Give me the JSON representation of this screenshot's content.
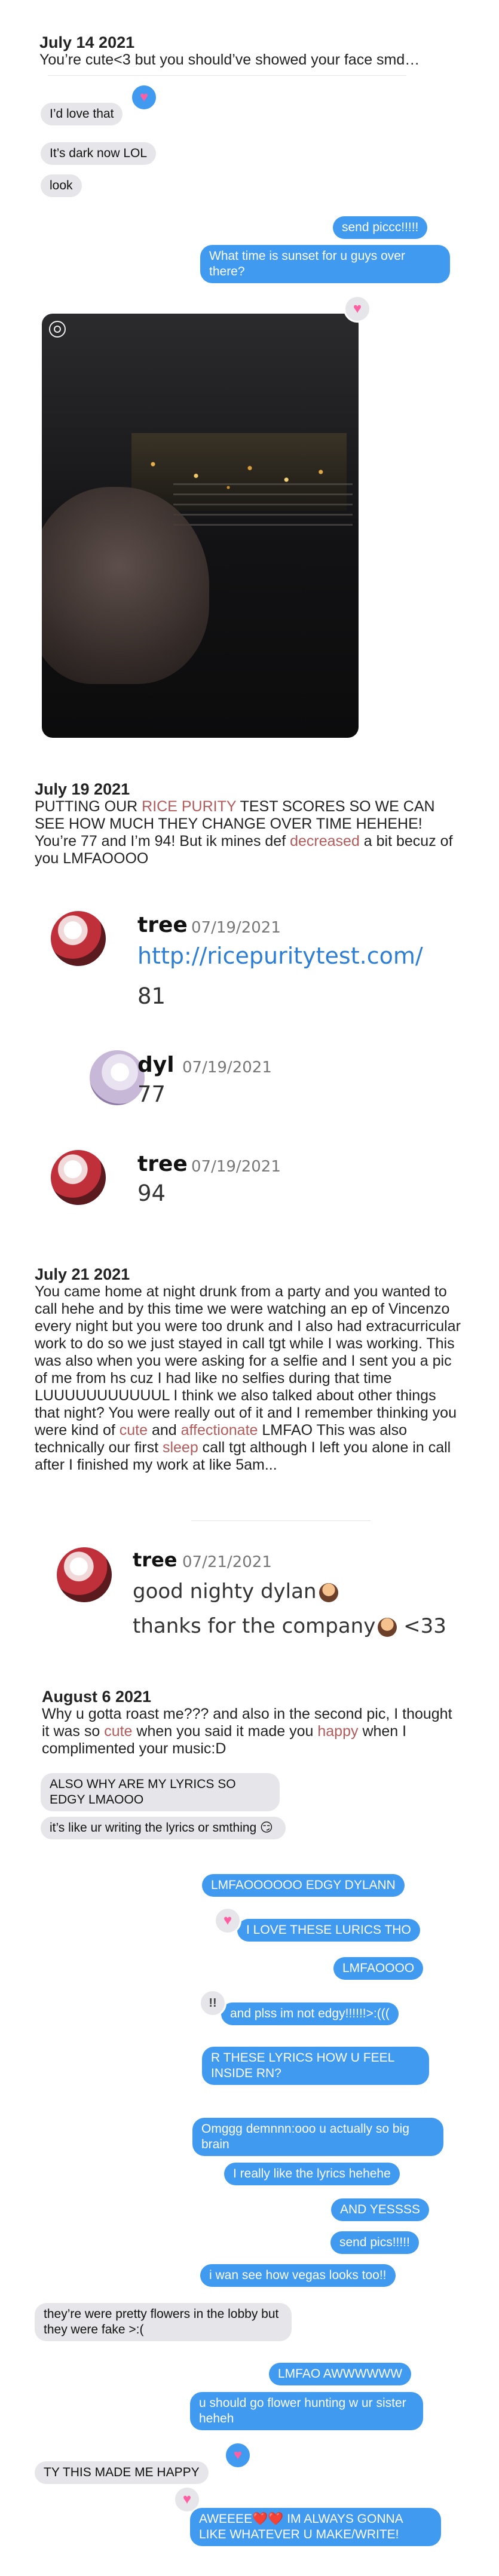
{
  "s1": {
    "date": "July 14 2021",
    "text": "You’re cute<3 but you should’ve showed your face smd…"
  },
  "m1": [
    {
      "text": "I’d love that"
    },
    {
      "text": "It’s dark now LOL"
    },
    {
      "text": "look"
    }
  ],
  "m1_out": [
    {
      "text": "send piccc!!!!!"
    },
    {
      "text": "What time is sunset for u guys over there?"
    }
  ],
  "s2": {
    "date": "July 19 2021",
    "p1": "PUTTING OUR ",
    "hl1": "RICE PURITY",
    "p2": " TEST SCORES SO WE CAN SEE HOW MUCH THEY CHANGE OVER TIME HEHEHE! You’re 77 and I’m 94! But ik mines def ",
    "hl2": "decreased",
    "p3": " a bit becuz of you LMFAOOOO"
  },
  "discord": [
    {
      "name": "tree",
      "date": "07/19/2021",
      "link": "http://ricepuritytest.com/",
      "msg": "81"
    },
    {
      "name": "dyl",
      "date": "07/19/2021",
      "msg": "77"
    },
    {
      "name": "tree",
      "date": "07/19/2021",
      "msg": "94"
    }
  ],
  "s3": {
    "date": "July 21 2021",
    "p1": "You came home at night drunk from a party and you wanted to call hehe and by this time we were watching an ep of Vincenzo every night but you were too drunk and I also had extracurricular work to do so we just stayed in call tgt while I was working. This was also when you were asking for a selfie and I sent you a pic of me from hs cuz I had like no selfies during that time LUUUUUUUUUUUL I think we also talked about other things that night? You were really out of it and I remember thinking you were kind of ",
    "hl1": "cute",
    "p2": " and ",
    "hl2": "affectionate",
    "p3": " LMFAO This was also technically our first ",
    "hl3": "sleep",
    "p4": " call tgt although I left you alone in call after I finished my work at like 5am..."
  },
  "discord2": {
    "name": "tree",
    "date": "07/21/2021",
    "msg1": "good nighty dylan",
    "msg2": "thanks for the company",
    "msg2_suffix": " <33"
  },
  "s4": {
    "date": "August 6 2021",
    "p1": "Why u gotta roast me??? and also in the second pic, I thought it was so ",
    "hl1": "cute",
    "p2": " when you said it made you ",
    "hl2": "happy",
    "p3": " when I complimented your music:D"
  },
  "m2": [
    {
      "text": "ALSO WHY ARE MY LYRICS SO EDGY LMAOOO"
    },
    {
      "text": "it’s like ur writing the lyrics or smthing 😏"
    },
    {
      "text": "LMFAOOOOOO EDGY DYLANN"
    },
    {
      "text": "I LOVE THESE LURICS THO"
    },
    {
      "text": "LMFAOOOO"
    },
    {
      "text": "and plss im not edgy!!!!!!>:((("
    },
    {
      "text": "R THESE LYRICS HOW U FEEL INSIDE RN?"
    },
    {
      "text": "Omggg demnnn:ooo u actually so big brain"
    },
    {
      "text": "I really like the lyrics hehehe"
    },
    {
      "text": "AND YESSSS"
    },
    {
      "text": "send pics!!!!!"
    },
    {
      "text": "i wan see how vegas looks too!!"
    },
    {
      "text": "they’re were pretty flowers in the lobby but they were fake >:("
    },
    {
      "text": "LMFAO AWWWWWW"
    },
    {
      "text": "u should go flower hunting w ur sister heheh"
    },
    {
      "text": "TY THIS MADE ME HAPPY"
    },
    {
      "text": "AWEEEE❤️❤️ IM ALWAYS GONNA LIKE WHATEVER U MAKE/WRITE!"
    }
  ],
  "reactions": {
    "heart": "♥",
    "exclaim": "!!"
  },
  "colors": {
    "outgoing": "#3f9af0",
    "incoming": "#e6e6ea",
    "highlight": "#b45a5a",
    "heart": "#ff5fa2"
  }
}
